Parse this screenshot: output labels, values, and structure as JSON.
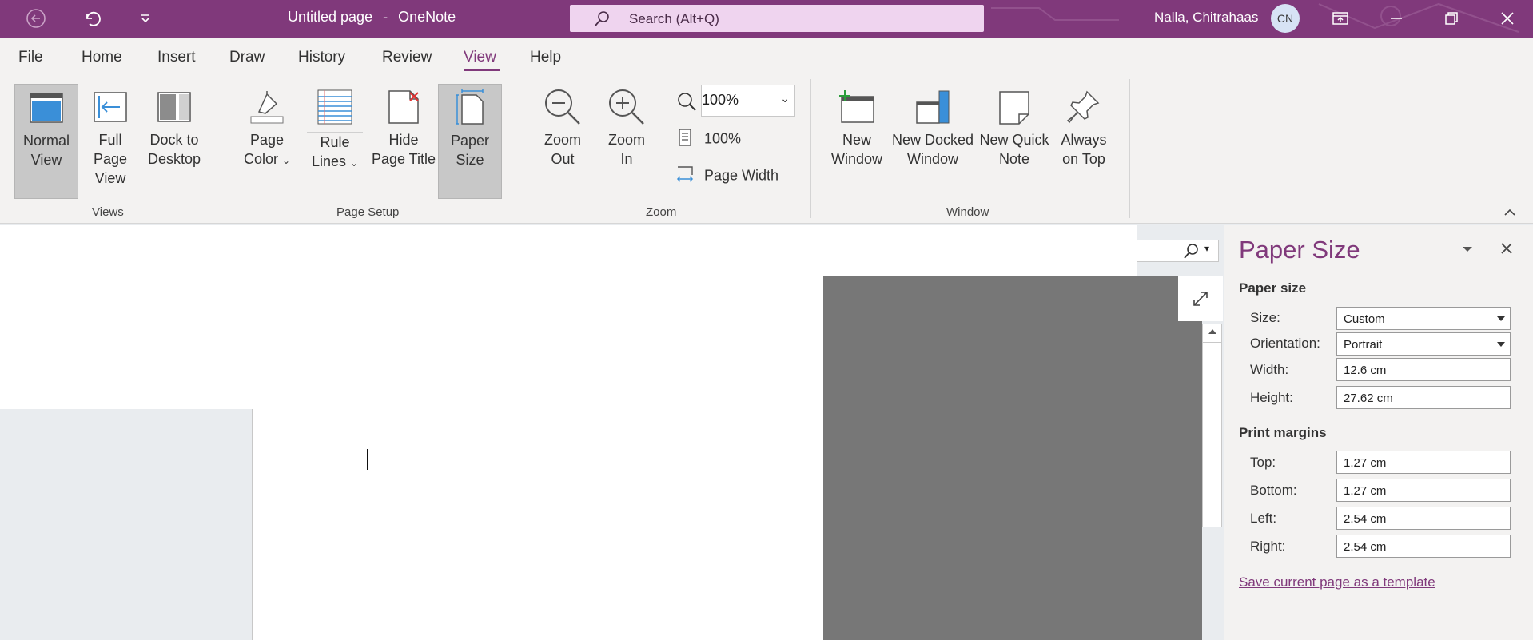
{
  "titlebar": {
    "title": "Untitled page",
    "sep": "-",
    "app": "OneNote",
    "search_placeholder": "Search (Alt+Q)",
    "user_name": "Nalla, Chitrahaas",
    "user_initials": "CN"
  },
  "menu": [
    "File",
    "Home",
    "Insert",
    "Draw",
    "History",
    "Review",
    "View",
    "Help"
  ],
  "active_tab": "View",
  "ribbon": {
    "views": {
      "label": "Views",
      "normal": [
        "Normal",
        "View"
      ],
      "fullpage": [
        "Full Page",
        "View"
      ],
      "dock": [
        "Dock to",
        "Desktop"
      ]
    },
    "page_setup": {
      "label": "Page Setup",
      "page_color": [
        "Page",
        "Color"
      ],
      "rule_lines": [
        "Rule",
        "Lines"
      ],
      "hide_title": [
        "Hide",
        "Page Title"
      ],
      "paper_size": [
        "Paper",
        "Size"
      ]
    },
    "zoom": {
      "label": "Zoom",
      "zoom_out": [
        "Zoom",
        "Out"
      ],
      "zoom_in": [
        "Zoom",
        "In"
      ],
      "zoom_value": "100%",
      "hundred": "100%",
      "page_width": "Page Width"
    },
    "window": {
      "label": "Window",
      "new_window": [
        "New",
        "Window"
      ],
      "new_docked": [
        "New Docked",
        "Window"
      ],
      "quick_note": [
        "New Quick",
        "Note"
      ],
      "always_top": [
        "Always",
        "on Top"
      ]
    }
  },
  "pane": {
    "title": "Paper Size",
    "paper_heading": "Paper size",
    "size_label": "Size:",
    "size_value": "Custom",
    "orientation_label": "Orientation:",
    "orientation_value": "Portrait",
    "width_label": "Width:",
    "width_value": "12.6 cm",
    "height_label": "Height:",
    "height_value": "27.62 cm",
    "margins_heading": "Print margins",
    "top_label": "Top:",
    "top_value": "1.27 cm",
    "bottom_label": "Bottom:",
    "bottom_value": "1.27 cm",
    "left_label": "Left:",
    "left_value": "2.54 cm",
    "right_label": "Right:",
    "right_value": "2.54 cm",
    "template_link": "Save current page as a template"
  },
  "colors": {
    "brand": "#80397b",
    "ribbon_bg": "#f3f2f1",
    "selected_btn": "#c8c8c8",
    "canvas_grey": "#777777"
  },
  "icons": [
    "back-icon",
    "undo-icon",
    "customize-qat-icon",
    "search-icon",
    "ribbon-display-icon",
    "minimize-icon",
    "restore-icon",
    "close-icon"
  ]
}
